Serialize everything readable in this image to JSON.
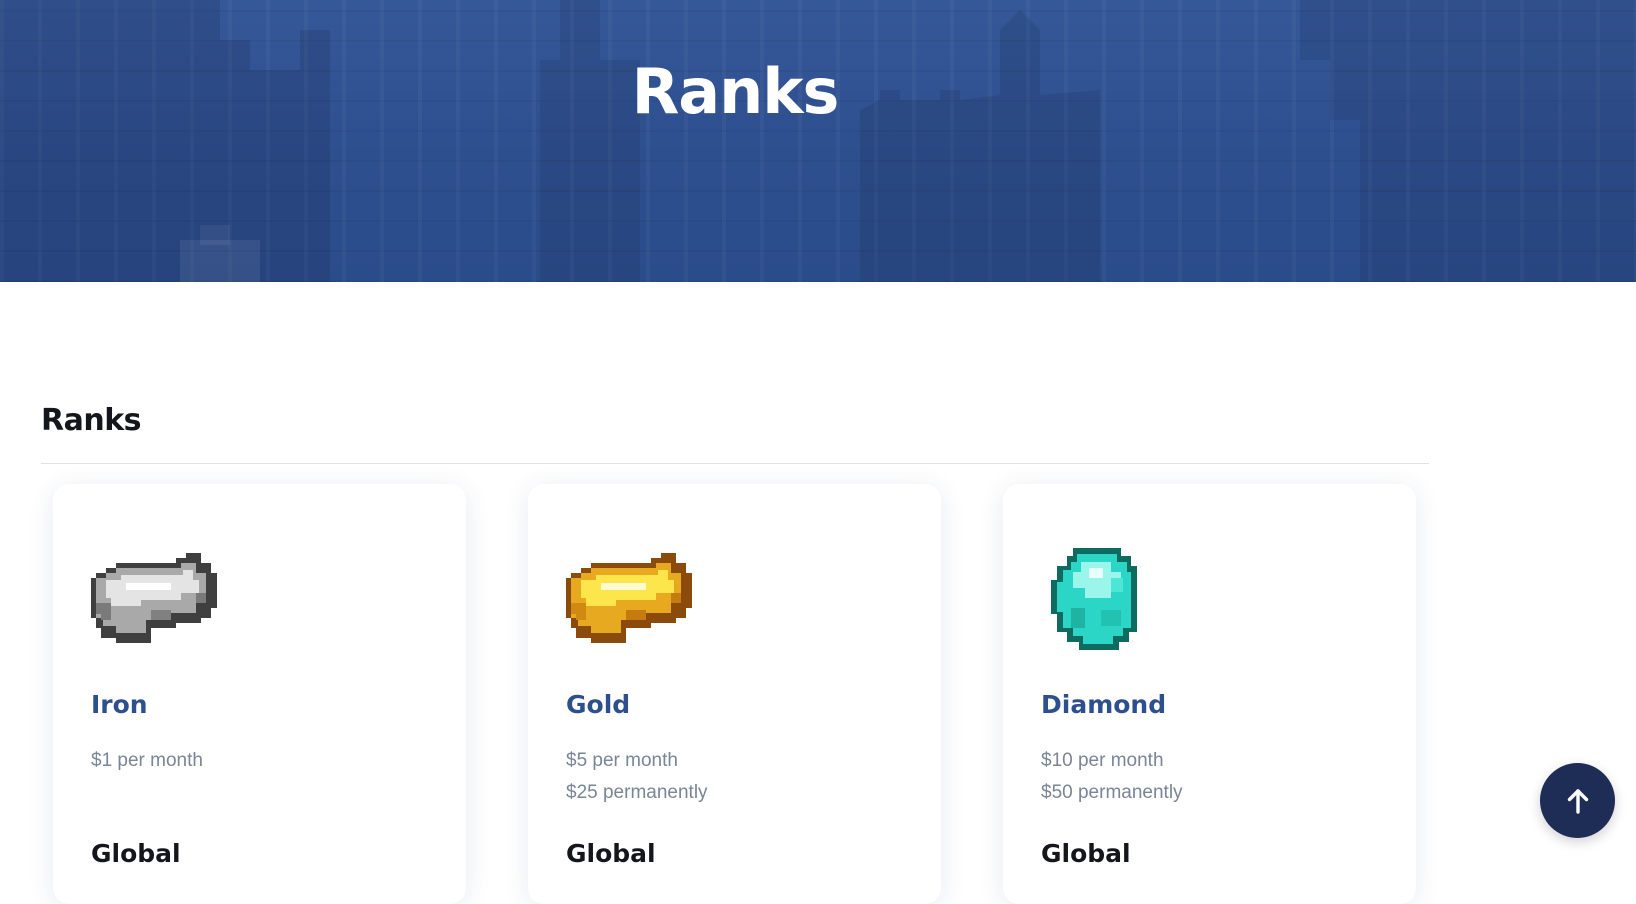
{
  "hero": {
    "title": "Ranks"
  },
  "section": {
    "title": "Ranks"
  },
  "ranks": [
    {
      "name": "Iron",
      "icon": "iron-ingot-icon",
      "prices": [
        "$1 per month"
      ],
      "perks_heading": "Global"
    },
    {
      "name": "Gold",
      "icon": "gold-ingot-icon",
      "prices": [
        "$5 per month",
        "$25 permanently"
      ],
      "perks_heading": "Global"
    },
    {
      "name": "Diamond",
      "icon": "diamond-icon",
      "prices": [
        "$10 per month",
        "$50 permanently"
      ],
      "perks_heading": "Global"
    }
  ],
  "back_to_top": {
    "icon": "arrow-up-icon"
  },
  "colors": {
    "hero_blue": "#2e4f8e",
    "rank_name": "#2e4f8e",
    "price_text": "#7a8597",
    "back_to_top_bg": "#1d2d56"
  }
}
